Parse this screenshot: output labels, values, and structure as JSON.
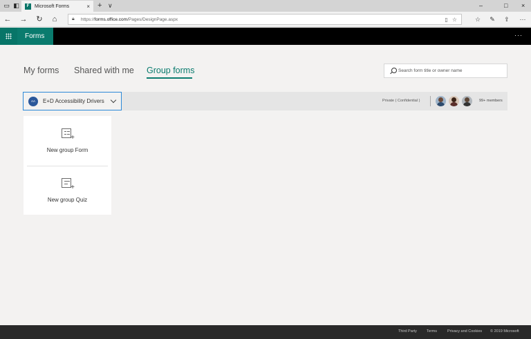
{
  "browser": {
    "tab_title": "Microsoft Forms",
    "tab_favicon": "F",
    "tab_close": "×",
    "new_tab": "+",
    "tab_menu": "∨",
    "url_prefix": "https://",
    "url_domain": "forms.office.com",
    "url_path": "/Pages/DesignPage.aspx",
    "window_controls": {
      "minimize": "–",
      "maximize": "□",
      "close": "×"
    }
  },
  "app": {
    "name": "Forms",
    "more": "···"
  },
  "tabs": [
    {
      "label": "My forms",
      "active": false
    },
    {
      "label": "Shared with me",
      "active": false
    },
    {
      "label": "Group forms",
      "active": true
    }
  ],
  "search": {
    "placeholder": "Search form title or owner name",
    "value": ""
  },
  "group": {
    "avatar_initials": "AA",
    "name": "E+D Accessibility Drivers",
    "privacy": "Private ( Confidential )",
    "members_label": "99+ members",
    "member_avatars": [
      "member-1",
      "member-2",
      "member-3"
    ]
  },
  "cards": [
    {
      "label": "New group Form",
      "icon": "form-icon"
    },
    {
      "label": "New group Quiz",
      "icon": "quiz-icon"
    }
  ],
  "footer": {
    "links": [
      "Third Party",
      "Terms",
      "Privacy and Cookies",
      "© 2019 Microsoft"
    ]
  },
  "colors": {
    "brand": "#077568",
    "accent_blue": "#2b88d8",
    "header_bg": "#000000",
    "footer_bg": "#292929"
  }
}
